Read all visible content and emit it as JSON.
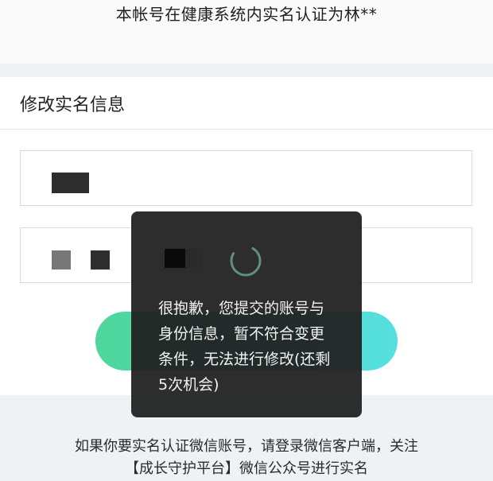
{
  "header": {
    "verified_text": "本帐号在健康系统内实名认证为林**"
  },
  "form": {
    "section_title": "修改实名信息",
    "name_field": {
      "value": ""
    },
    "id_field": {
      "value": ""
    },
    "submit_label": ""
  },
  "toast": {
    "message_lines": [
      "很抱歉，您提交的账号与",
      "身份信息，暂不符合变更",
      "条件，无法进行修改(还剩",
      "5次机会)"
    ],
    "icon": "loading-spinner-icon"
  },
  "footer": {
    "lines": [
      "如果你要实名认证微信账号，请登录微信客户端，关注",
      "【成长守护平台】微信公众号进行实名"
    ]
  },
  "colors": {
    "accent_start": "#4fd69a",
    "accent_end": "#55dfe0",
    "toast_bg": "#202020",
    "band_bg": "#eef2f4"
  }
}
